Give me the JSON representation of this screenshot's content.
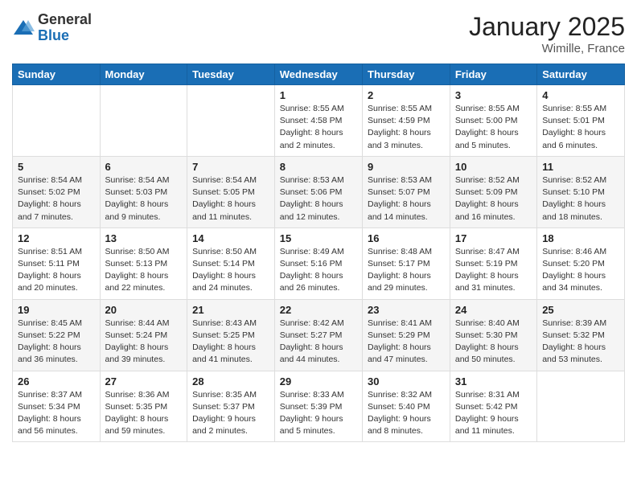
{
  "logo": {
    "general": "General",
    "blue": "Blue"
  },
  "header": {
    "month": "January 2025",
    "location": "Wimille, France"
  },
  "days_of_week": [
    "Sunday",
    "Monday",
    "Tuesday",
    "Wednesday",
    "Thursday",
    "Friday",
    "Saturday"
  ],
  "weeks": [
    [
      {
        "day": "",
        "content": ""
      },
      {
        "day": "",
        "content": ""
      },
      {
        "day": "",
        "content": ""
      },
      {
        "day": "1",
        "content": "Sunrise: 8:55 AM\nSunset: 4:58 PM\nDaylight: 8 hours and 2 minutes."
      },
      {
        "day": "2",
        "content": "Sunrise: 8:55 AM\nSunset: 4:59 PM\nDaylight: 8 hours and 3 minutes."
      },
      {
        "day": "3",
        "content": "Sunrise: 8:55 AM\nSunset: 5:00 PM\nDaylight: 8 hours and 5 minutes."
      },
      {
        "day": "4",
        "content": "Sunrise: 8:55 AM\nSunset: 5:01 PM\nDaylight: 8 hours and 6 minutes."
      }
    ],
    [
      {
        "day": "5",
        "content": "Sunrise: 8:54 AM\nSunset: 5:02 PM\nDaylight: 8 hours and 7 minutes."
      },
      {
        "day": "6",
        "content": "Sunrise: 8:54 AM\nSunset: 5:03 PM\nDaylight: 8 hours and 9 minutes."
      },
      {
        "day": "7",
        "content": "Sunrise: 8:54 AM\nSunset: 5:05 PM\nDaylight: 8 hours and 11 minutes."
      },
      {
        "day": "8",
        "content": "Sunrise: 8:53 AM\nSunset: 5:06 PM\nDaylight: 8 hours and 12 minutes."
      },
      {
        "day": "9",
        "content": "Sunrise: 8:53 AM\nSunset: 5:07 PM\nDaylight: 8 hours and 14 minutes."
      },
      {
        "day": "10",
        "content": "Sunrise: 8:52 AM\nSunset: 5:09 PM\nDaylight: 8 hours and 16 minutes."
      },
      {
        "day": "11",
        "content": "Sunrise: 8:52 AM\nSunset: 5:10 PM\nDaylight: 8 hours and 18 minutes."
      }
    ],
    [
      {
        "day": "12",
        "content": "Sunrise: 8:51 AM\nSunset: 5:11 PM\nDaylight: 8 hours and 20 minutes."
      },
      {
        "day": "13",
        "content": "Sunrise: 8:50 AM\nSunset: 5:13 PM\nDaylight: 8 hours and 22 minutes."
      },
      {
        "day": "14",
        "content": "Sunrise: 8:50 AM\nSunset: 5:14 PM\nDaylight: 8 hours and 24 minutes."
      },
      {
        "day": "15",
        "content": "Sunrise: 8:49 AM\nSunset: 5:16 PM\nDaylight: 8 hours and 26 minutes."
      },
      {
        "day": "16",
        "content": "Sunrise: 8:48 AM\nSunset: 5:17 PM\nDaylight: 8 hours and 29 minutes."
      },
      {
        "day": "17",
        "content": "Sunrise: 8:47 AM\nSunset: 5:19 PM\nDaylight: 8 hours and 31 minutes."
      },
      {
        "day": "18",
        "content": "Sunrise: 8:46 AM\nSunset: 5:20 PM\nDaylight: 8 hours and 34 minutes."
      }
    ],
    [
      {
        "day": "19",
        "content": "Sunrise: 8:45 AM\nSunset: 5:22 PM\nDaylight: 8 hours and 36 minutes."
      },
      {
        "day": "20",
        "content": "Sunrise: 8:44 AM\nSunset: 5:24 PM\nDaylight: 8 hours and 39 minutes."
      },
      {
        "day": "21",
        "content": "Sunrise: 8:43 AM\nSunset: 5:25 PM\nDaylight: 8 hours and 41 minutes."
      },
      {
        "day": "22",
        "content": "Sunrise: 8:42 AM\nSunset: 5:27 PM\nDaylight: 8 hours and 44 minutes."
      },
      {
        "day": "23",
        "content": "Sunrise: 8:41 AM\nSunset: 5:29 PM\nDaylight: 8 hours and 47 minutes."
      },
      {
        "day": "24",
        "content": "Sunrise: 8:40 AM\nSunset: 5:30 PM\nDaylight: 8 hours and 50 minutes."
      },
      {
        "day": "25",
        "content": "Sunrise: 8:39 AM\nSunset: 5:32 PM\nDaylight: 8 hours and 53 minutes."
      }
    ],
    [
      {
        "day": "26",
        "content": "Sunrise: 8:37 AM\nSunset: 5:34 PM\nDaylight: 8 hours and 56 minutes."
      },
      {
        "day": "27",
        "content": "Sunrise: 8:36 AM\nSunset: 5:35 PM\nDaylight: 8 hours and 59 minutes."
      },
      {
        "day": "28",
        "content": "Sunrise: 8:35 AM\nSunset: 5:37 PM\nDaylight: 9 hours and 2 minutes."
      },
      {
        "day": "29",
        "content": "Sunrise: 8:33 AM\nSunset: 5:39 PM\nDaylight: 9 hours and 5 minutes."
      },
      {
        "day": "30",
        "content": "Sunrise: 8:32 AM\nSunset: 5:40 PM\nDaylight: 9 hours and 8 minutes."
      },
      {
        "day": "31",
        "content": "Sunrise: 8:31 AM\nSunset: 5:42 PM\nDaylight: 9 hours and 11 minutes."
      },
      {
        "day": "",
        "content": ""
      }
    ]
  ]
}
